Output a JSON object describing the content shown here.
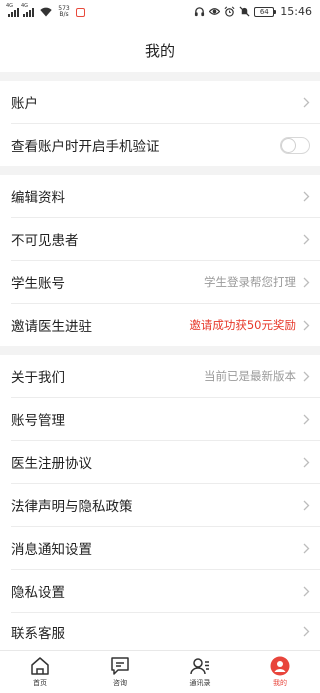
{
  "status_bar": {
    "net_speed_value": "573",
    "net_speed_unit": "B/s",
    "battery": "64",
    "time": "15:46"
  },
  "header": {
    "title": "我的"
  },
  "section1": {
    "account": {
      "label": "账户"
    },
    "phone_verify": {
      "label": "查看账户时开启手机验证",
      "enabled": false
    }
  },
  "section2": {
    "edit_profile": {
      "label": "编辑资料"
    },
    "hidden_patients": {
      "label": "不可见患者"
    },
    "student_account": {
      "label": "学生账号",
      "value": "学生登录帮您打理"
    },
    "invite_doctor": {
      "label": "邀请医生进驻",
      "value": "邀请成功获50元奖励"
    }
  },
  "section3": {
    "about": {
      "label": "关于我们",
      "value": "当前已是最新版本"
    },
    "account_manage": {
      "label": "账号管理"
    },
    "register_agreement": {
      "label": "医生注册协议"
    },
    "legal_privacy": {
      "label": "法律声明与隐私政策"
    },
    "notification_settings": {
      "label": "消息通知设置"
    },
    "privacy_settings": {
      "label": "隐私设置"
    },
    "contact_service": {
      "label": "联系客服"
    }
  },
  "tabbar": {
    "home": "首页",
    "consult": "咨询",
    "contacts": "通讯录",
    "mine": "我的",
    "active": "mine"
  },
  "colors": {
    "accent": "#e8453c",
    "value_red": "#e7382a",
    "gap_background": "#f3f3f3"
  }
}
